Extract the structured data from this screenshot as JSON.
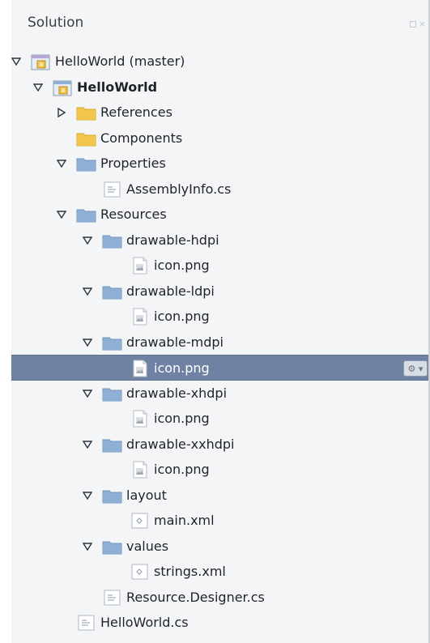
{
  "panel": {
    "title": "Solution"
  },
  "tree": {
    "items": [
      {
        "label": "HelloWorld (master)",
        "kind": "solution",
        "level": 0,
        "expanded": true
      },
      {
        "label": "HelloWorld",
        "kind": "project",
        "level": 1,
        "expanded": true,
        "bold": true
      },
      {
        "label": "References",
        "kind": "folder-yellow",
        "level": 2,
        "expanded": false
      },
      {
        "label": "Components",
        "kind": "folder-yellow",
        "level": 2,
        "expandable": false
      },
      {
        "label": "Properties",
        "kind": "folder-blue",
        "level": 2,
        "expanded": true
      },
      {
        "label": "AssemblyInfo.cs",
        "kind": "file-cs",
        "level": 3
      },
      {
        "label": "Resources",
        "kind": "folder-blue",
        "level": 2,
        "expanded": true
      },
      {
        "label": "drawable-hdpi",
        "kind": "folder-blue",
        "level": 3,
        "expanded": true
      },
      {
        "label": "icon.png",
        "kind": "file-image",
        "level": 4
      },
      {
        "label": "drawable-ldpi",
        "kind": "folder-blue",
        "level": 3,
        "expanded": true
      },
      {
        "label": "icon.png",
        "kind": "file-image",
        "level": 4
      },
      {
        "label": "drawable-mdpi",
        "kind": "folder-blue",
        "level": 3,
        "expanded": true
      },
      {
        "label": "icon.png",
        "kind": "file-image",
        "level": 4,
        "selected": true
      },
      {
        "label": "drawable-xhdpi",
        "kind": "folder-blue",
        "level": 3,
        "expanded": true
      },
      {
        "label": "icon.png",
        "kind": "file-image",
        "level": 4
      },
      {
        "label": "drawable-xxhdpi",
        "kind": "folder-blue",
        "level": 3,
        "expanded": true
      },
      {
        "label": "icon.png",
        "kind": "file-image",
        "level": 4
      },
      {
        "label": "layout",
        "kind": "folder-blue",
        "level": 3,
        "expanded": true
      },
      {
        "label": "main.xml",
        "kind": "file-xml",
        "level": 4
      },
      {
        "label": "values",
        "kind": "folder-blue",
        "level": 3,
        "expanded": true
      },
      {
        "label": "strings.xml",
        "kind": "file-xml",
        "level": 4
      },
      {
        "label": "Resource.Designer.cs",
        "kind": "file-cs",
        "level": 3
      },
      {
        "label": "HelloWorld.cs",
        "kind": "file-cs",
        "level": 2
      }
    ]
  },
  "colors": {
    "selection": "#6f82a3",
    "panel_background": "#f4f5f7",
    "folder_blue": "#8fb0d3",
    "folder_yellow": "#f2c64a"
  }
}
